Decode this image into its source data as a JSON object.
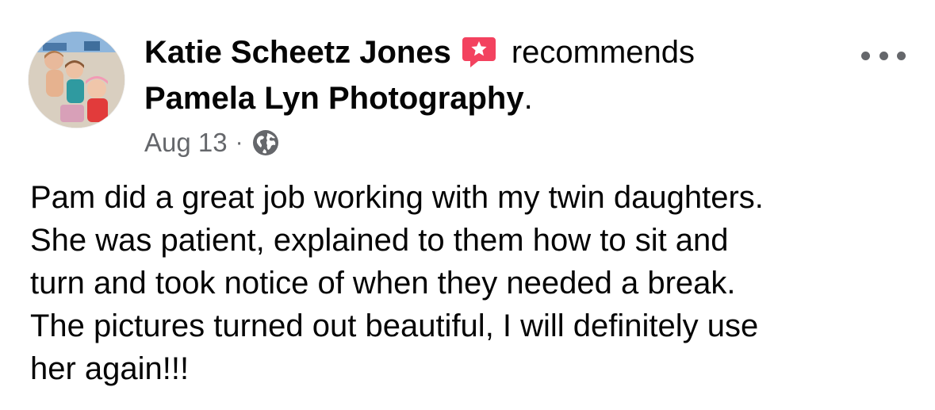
{
  "post": {
    "author": "Katie Scheetz Jones",
    "action": "recommends",
    "page_name": "Pamela Lyn Photography",
    "page_suffix": ".",
    "date": "Aug 13",
    "separator": "·",
    "privacy_icon": "globe-icon",
    "recommend_icon": "star-speech-bubble-icon",
    "more_icon": "more-options-icon",
    "body_lines": [
      "Pam did a great job working with my twin daughters.",
      "She was patient, explained to them how to sit and",
      "turn and took notice of when they needed a break.",
      "The pictures turned out beautiful, I will definitely use",
      "her again!!!"
    ]
  },
  "colors": {
    "text_primary": "#050505",
    "text_secondary": "#65676b",
    "recommend_badge": "#f3425f"
  }
}
